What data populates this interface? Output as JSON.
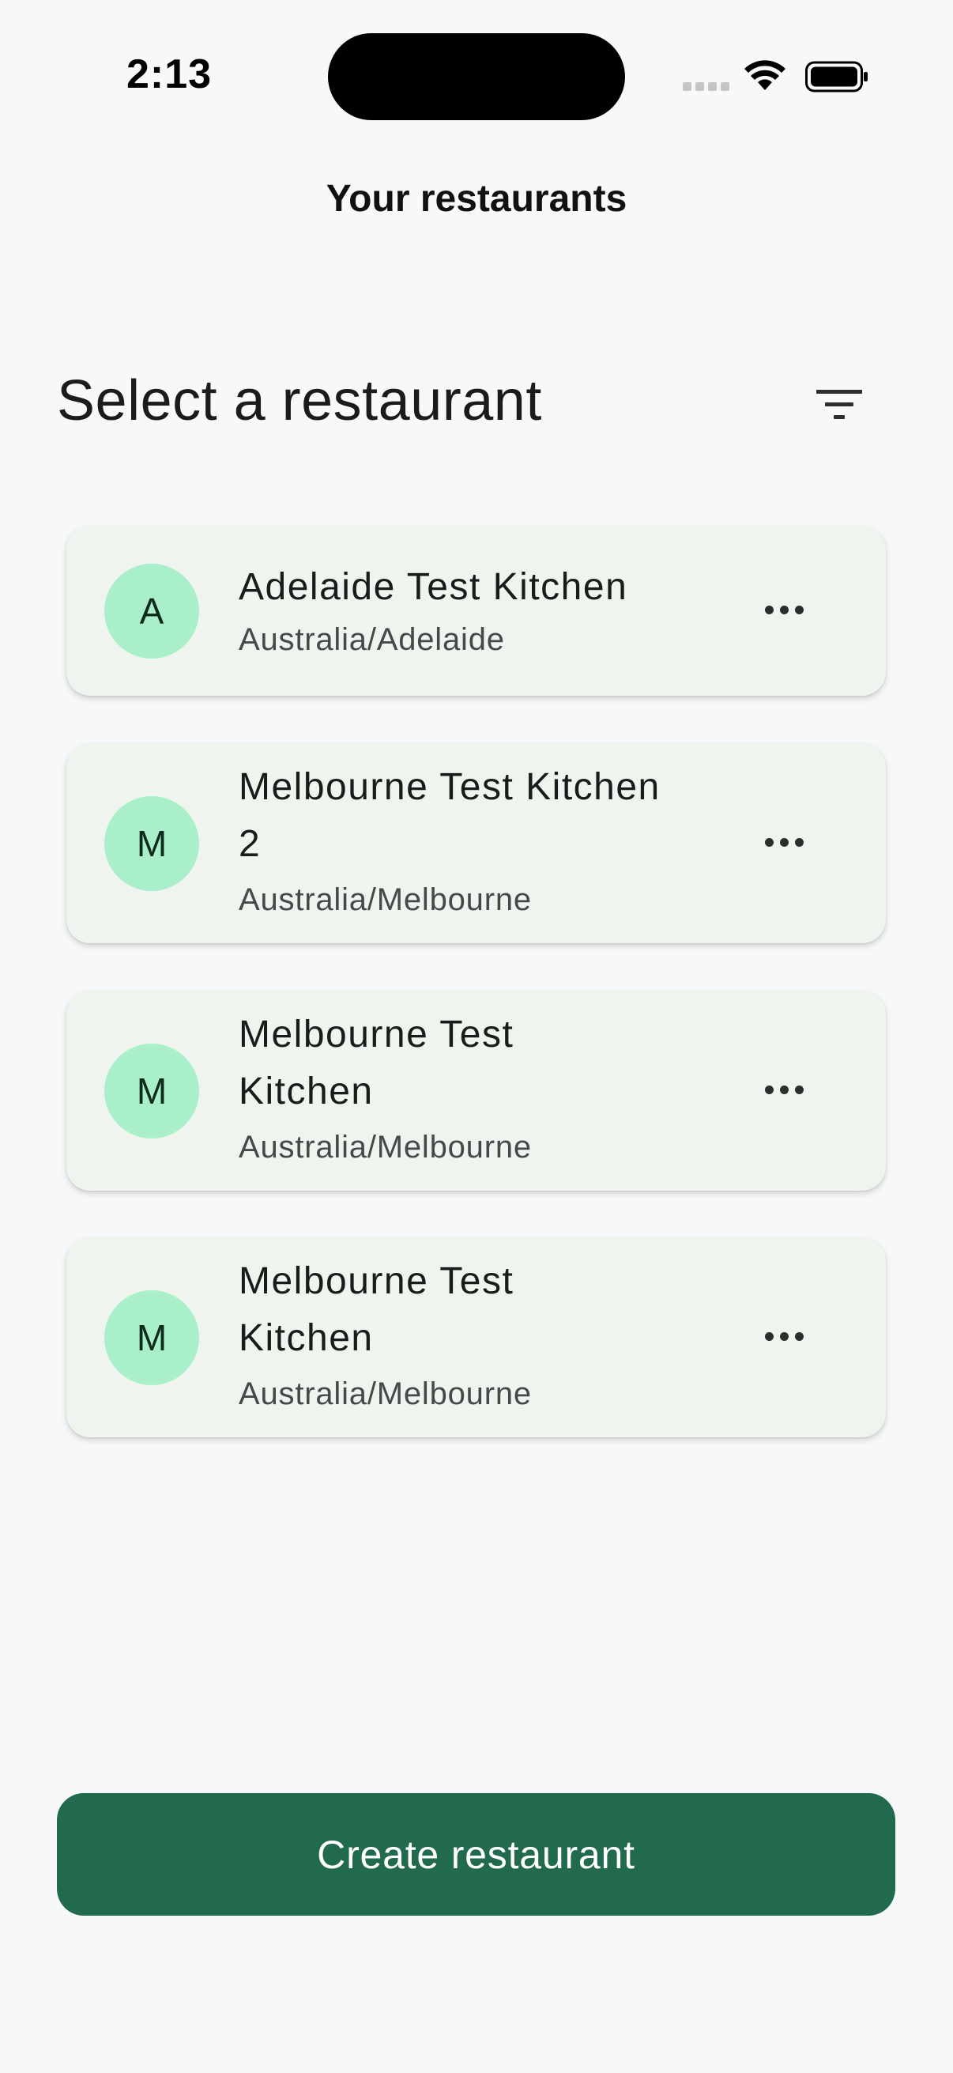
{
  "status_bar": {
    "time": "2:13"
  },
  "app_bar": {
    "title": "Your restaurants"
  },
  "main": {
    "heading": "Select a restaurant",
    "filter_icon": "filter-list-icon",
    "restaurants": [
      {
        "initial": "A",
        "name": "Adelaide Test Kitchen",
        "timezone": "Australia/Adelaide"
      },
      {
        "initial": "M",
        "name": "Melbourne Test Kitchen 2",
        "timezone": "Australia/Melbourne"
      },
      {
        "initial": "M",
        "name": "Melbourne Test Kitchen",
        "timezone": "Australia/Melbourne"
      },
      {
        "initial": "M",
        "name": "Melbourne Test Kitchen",
        "timezone": "Australia/Melbourne"
      }
    ],
    "more_icon": "more-horizontal-icon"
  },
  "footer": {
    "create_label": "Create restaurant"
  },
  "colors": {
    "background": "#f7f8fa",
    "card": "#eff4ef",
    "avatar": "#a9efc9",
    "primary_button": "#216a4e"
  }
}
